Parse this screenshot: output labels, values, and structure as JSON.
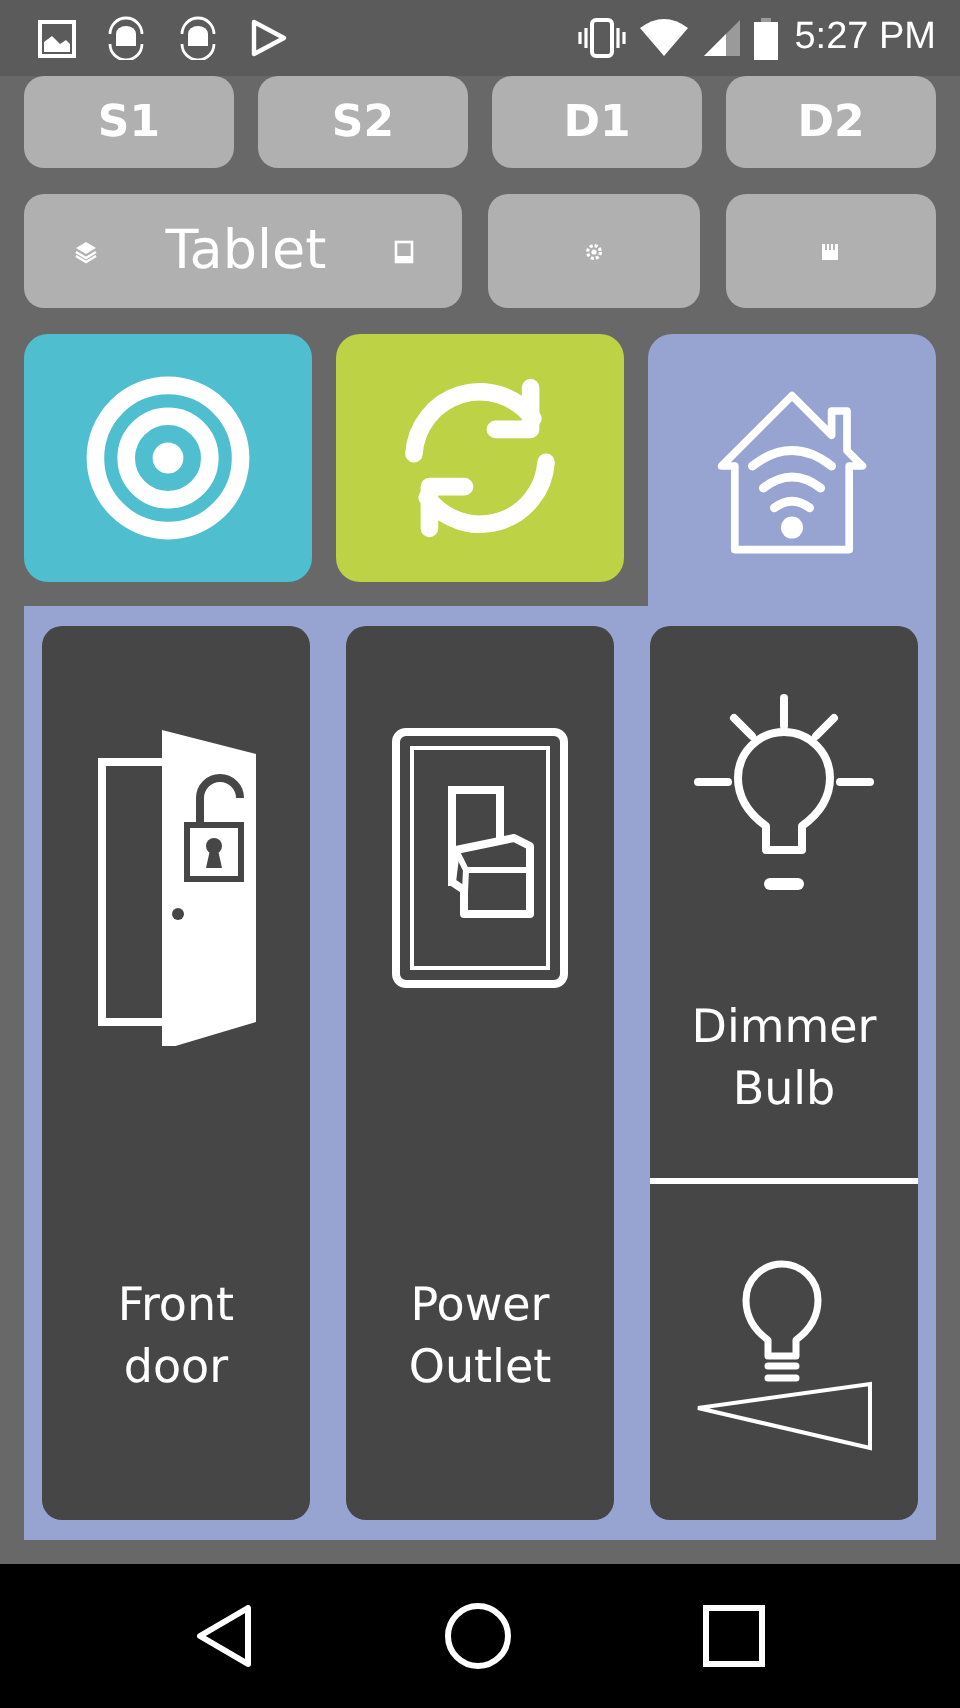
{
  "status_bar": {
    "time": "5:27 PM"
  },
  "scene_buttons": [
    {
      "label": "S1"
    },
    {
      "label": "S2"
    },
    {
      "label": "D1"
    },
    {
      "label": "D2"
    }
  ],
  "profile_row": {
    "profile": {
      "label": "Tablet"
    }
  },
  "tabs": [
    {
      "kind": "target",
      "selected": false,
      "color": "#4fbfcf"
    },
    {
      "kind": "sync",
      "selected": false,
      "color": "#bdd244"
    },
    {
      "kind": "home",
      "selected": true,
      "color": "#97a4d2"
    }
  ],
  "devices": [
    {
      "kind": "door",
      "label": "Front door"
    },
    {
      "kind": "outlet",
      "label": "Power Outlet"
    },
    {
      "kind": "dimmer",
      "label": "Dimmer Bulb"
    }
  ]
}
